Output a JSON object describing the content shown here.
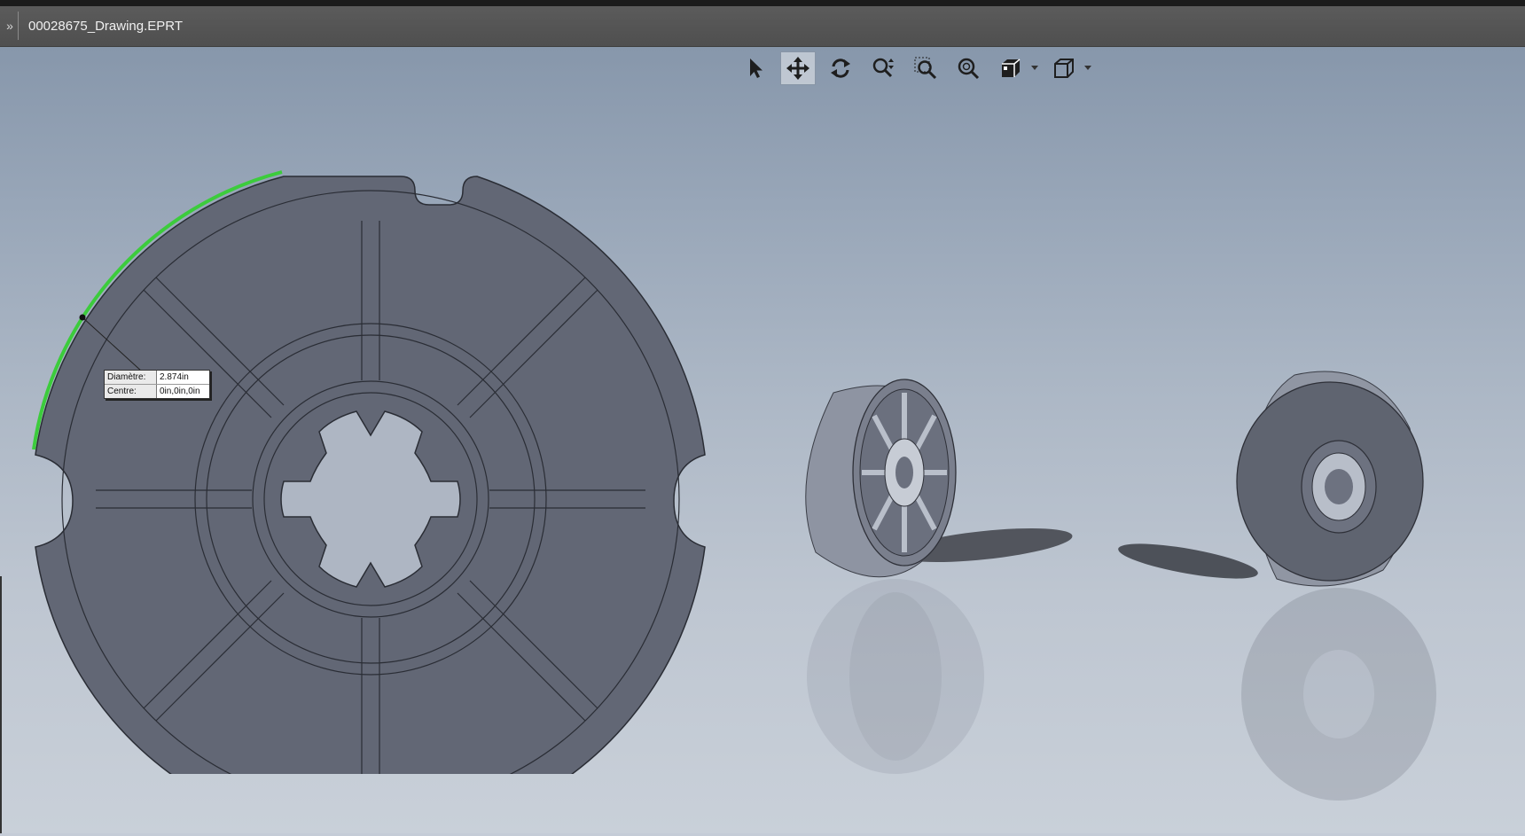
{
  "window": {
    "title": "00028675_Drawing.EPRT"
  },
  "titlebar": {
    "expand_glyph": "»"
  },
  "toolbar": {
    "tools": [
      {
        "name": "select-icon",
        "active": false
      },
      {
        "name": "pan-icon",
        "active": true
      },
      {
        "name": "rotate-icon",
        "active": false
      },
      {
        "name": "zoom-icon",
        "active": false
      },
      {
        "name": "zoom-to-area-icon",
        "active": false
      },
      {
        "name": "zoom-to-fit-icon",
        "active": false
      },
      {
        "name": "display-style-icon",
        "active": false
      },
      {
        "name": "view-orientation-icon",
        "active": false
      }
    ]
  },
  "measurement": {
    "diameter_label": "Diamètre:",
    "diameter_value": "2.874in",
    "center_label": "Centre:",
    "center_value": "0in,0in,0in"
  },
  "colors": {
    "part_face": "#626775",
    "part_edge": "#2a2d35",
    "highlight_edge": "#3ccc3c",
    "viewport_top": "#8797ab",
    "viewport_bottom": "#c9d0d9"
  }
}
